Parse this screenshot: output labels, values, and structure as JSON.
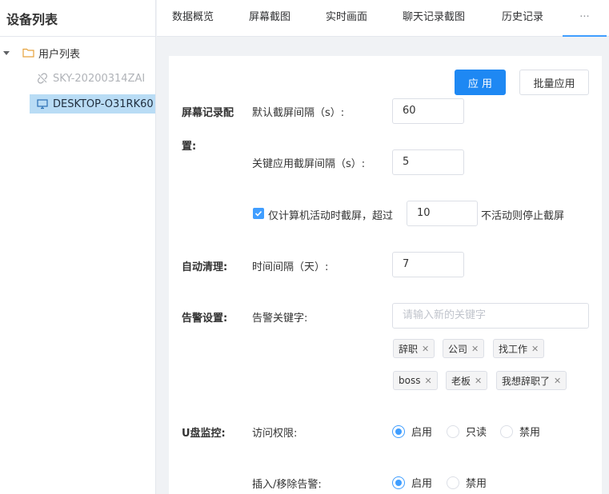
{
  "sidebar": {
    "title": "设备列表",
    "root_label": "用户列表",
    "devices": [
      {
        "name": "SKY-20200314ZAI",
        "status": "offline"
      },
      {
        "name": "DESKTOP-O31RK60",
        "status": "selected"
      }
    ]
  },
  "tabs": [
    {
      "label": "数据概览"
    },
    {
      "label": "屏幕截图"
    },
    {
      "label": "实时画面"
    },
    {
      "label": "聊天记录截图"
    },
    {
      "label": "历史记录"
    },
    {
      "label": "···"
    }
  ],
  "toolbar": {
    "apply_label": "应 用",
    "batch_apply_label": "批量应用"
  },
  "screen_record": {
    "section_line1": "屏幕记录配",
    "section_line2": "置:",
    "default_interval_label": "默认截屏间隔（s）:",
    "default_interval_value": "60",
    "key_app_interval_label": "关键应用截屏间隔（s）:",
    "key_app_interval_value": "5",
    "active_only_checked": true,
    "active_only_label": "仅计算机活动时截屏，超过",
    "inactive_value": "10",
    "inactive_suffix": "不活动则停止截屏"
  },
  "auto_clean": {
    "section": "自动清理:",
    "interval_label": "时间间隔（天）:",
    "interval_value": "7"
  },
  "alert": {
    "section": "告警设置:",
    "keyword_label": "告警关键字:",
    "keyword_placeholder": "请输入新的关键字",
    "keywords": [
      "辞职",
      "公司",
      "找工作",
      "boss",
      "老板",
      "我想辞职了"
    ]
  },
  "usb": {
    "section": "U盘监控:",
    "access_label": "访问权限:",
    "access_options": [
      "启用",
      "只读",
      "禁用"
    ],
    "access_selected": "启用",
    "plug_label": "插入/移除告警:",
    "plug_options": [
      "启用",
      "禁用"
    ],
    "plug_selected": "启用"
  },
  "colors": {
    "accent": "#409eff",
    "primary_button": "#1e88f3",
    "selected_node": "#b9dcf5"
  }
}
